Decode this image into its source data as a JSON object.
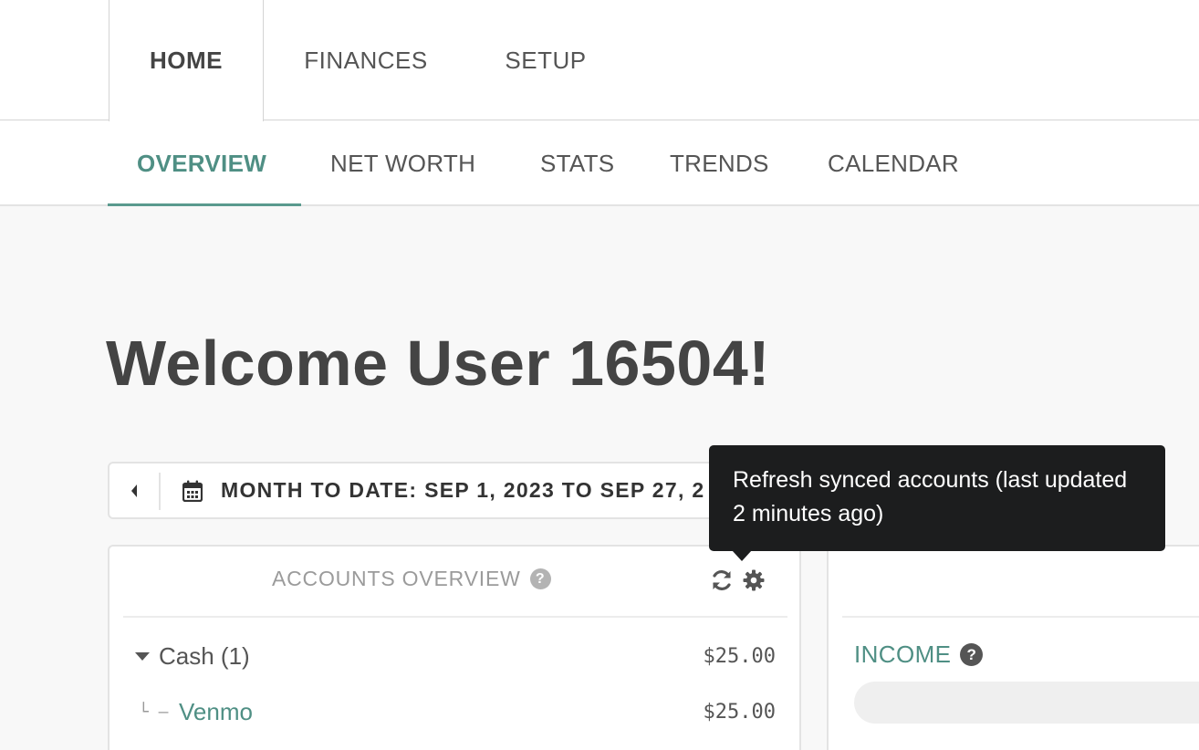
{
  "top_nav": {
    "tabs": [
      {
        "label": "HOME"
      },
      {
        "label": "FINANCES"
      },
      {
        "label": "SETUP"
      }
    ]
  },
  "sub_nav": {
    "tabs": [
      {
        "label": "OVERVIEW"
      },
      {
        "label": "NET WORTH"
      },
      {
        "label": "STATS"
      },
      {
        "label": "TRENDS"
      },
      {
        "label": "CALENDAR"
      }
    ]
  },
  "welcome": "Welcome User 16504!",
  "date_range": {
    "label": "MONTH TO DATE: SEP 1, 2023 TO SEP 27, 2",
    "icon_prev": "caret-left-icon",
    "icon_calendar": "calendar-icon"
  },
  "accounts_panel": {
    "title": "ACCOUNTS OVERVIEW",
    "help": "?",
    "groups": [
      {
        "name": "Cash (1)",
        "amount": "$25.00"
      }
    ],
    "accounts": [
      {
        "prefix": "└ –",
        "name": "Venmo",
        "amount": "$25.00"
      }
    ]
  },
  "income_panel": {
    "label": "INCOME",
    "help": "?"
  },
  "tooltip": {
    "text": "Refresh synced accounts (last updated 2 minutes ago)"
  },
  "colors": {
    "accent": "#4f8f84",
    "tooltip_bg": "#1c1d1e",
    "page_bg": "#f8f8f8"
  }
}
